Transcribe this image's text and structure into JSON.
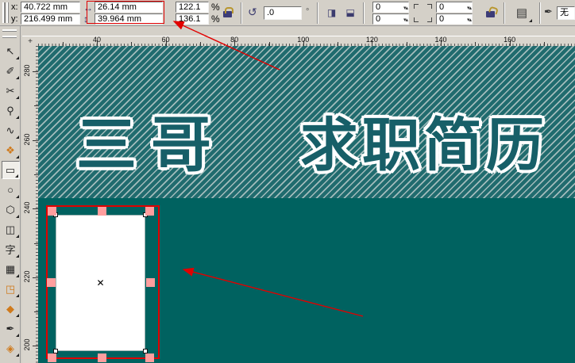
{
  "property_bar": {
    "x_label": "x:",
    "x_value": "40.722 mm",
    "y_label": "y:",
    "y_value": "216.499 mm",
    "width_value": "26.14 mm",
    "height_value": "39.964 mm",
    "scale_x_value": "122.1",
    "scale_y_value": "136.1",
    "percent": "%",
    "rotation_value": ".0",
    "degree": "°",
    "corner_top_left": "0",
    "corner_bottom_left": "0",
    "corner_top_right": "0",
    "corner_bottom_right": "0",
    "outline_width_value": "无",
    "icons": {
      "width_icon": "↔",
      "height_icon": "↕",
      "rotate_icon": "↺",
      "mirror_icon": "◨",
      "wrap_icon": "▤",
      "outline_pen_icon": "✒",
      "origin_icon": "+"
    }
  },
  "rulers": {
    "horizontal_labels": [
      40,
      60,
      80,
      100,
      120,
      140,
      160
    ],
    "vertical_labels": [
      280,
      260,
      240,
      220,
      200
    ]
  },
  "toolbox": {
    "items": [
      {
        "name": "pick-tool",
        "icon": "cursor-arrow-icon",
        "glyph": "↖",
        "color": "#222"
      },
      {
        "name": "shape-tool",
        "icon": "node-edit-icon",
        "glyph": "✐",
        "color": "#222"
      },
      {
        "name": "crop-tool",
        "icon": "crop-knife-icon",
        "glyph": "✂",
        "color": "#222"
      },
      {
        "name": "zoom-tool",
        "icon": "magnifier-icon",
        "glyph": "⚲",
        "color": "#222"
      },
      {
        "name": "freehand-tool",
        "icon": "curve-icon",
        "glyph": "∿",
        "color": "#222"
      },
      {
        "name": "smart-fill-tool",
        "icon": "smart-fill-icon",
        "glyph": "❖",
        "color": "#cf7a1c"
      },
      {
        "name": "rectangle-tool",
        "icon": "rectangle-icon",
        "glyph": "▭",
        "color": "#222",
        "pressed": true
      },
      {
        "name": "ellipse-tool",
        "icon": "ellipse-icon",
        "glyph": "○",
        "color": "#222"
      },
      {
        "name": "polygon-tool",
        "icon": "polygon-icon",
        "glyph": "⬡",
        "color": "#222"
      },
      {
        "name": "basic-shapes-tool",
        "icon": "basic-shapes-icon",
        "glyph": "◫",
        "color": "#222"
      },
      {
        "name": "text-tool",
        "icon": "text-icon",
        "glyph": "字",
        "color": "#222"
      },
      {
        "name": "table-tool",
        "icon": "table-icon",
        "glyph": "▦",
        "color": "#222"
      },
      {
        "name": "interactive-blend-tool",
        "icon": "blend-icon",
        "glyph": "◳",
        "color": "#cf7a1c"
      },
      {
        "name": "fill-tool",
        "icon": "paint-bucket-icon",
        "glyph": "◆",
        "color": "#cf7a1c"
      },
      {
        "name": "outline-pen-tool",
        "icon": "outline-pen-icon",
        "glyph": "✒",
        "color": "#222"
      },
      {
        "name": "fill-color-tool",
        "icon": "fill-color-icon",
        "glyph": "◈",
        "color": "#cf7a1c"
      }
    ]
  },
  "canvas": {
    "headline_left": "三哥",
    "headline_right": "求职简历",
    "center_marker": "✕"
  },
  "colors": {
    "teal_solid": "#006260",
    "teal_stripe_base": "#206b6e",
    "stripe_line": "#a3bcbc",
    "headline_fill": "#175f68",
    "annotation_red": "#e10000",
    "handle_pink": "#ff9e9e",
    "chrome": "#d4d0c8"
  }
}
